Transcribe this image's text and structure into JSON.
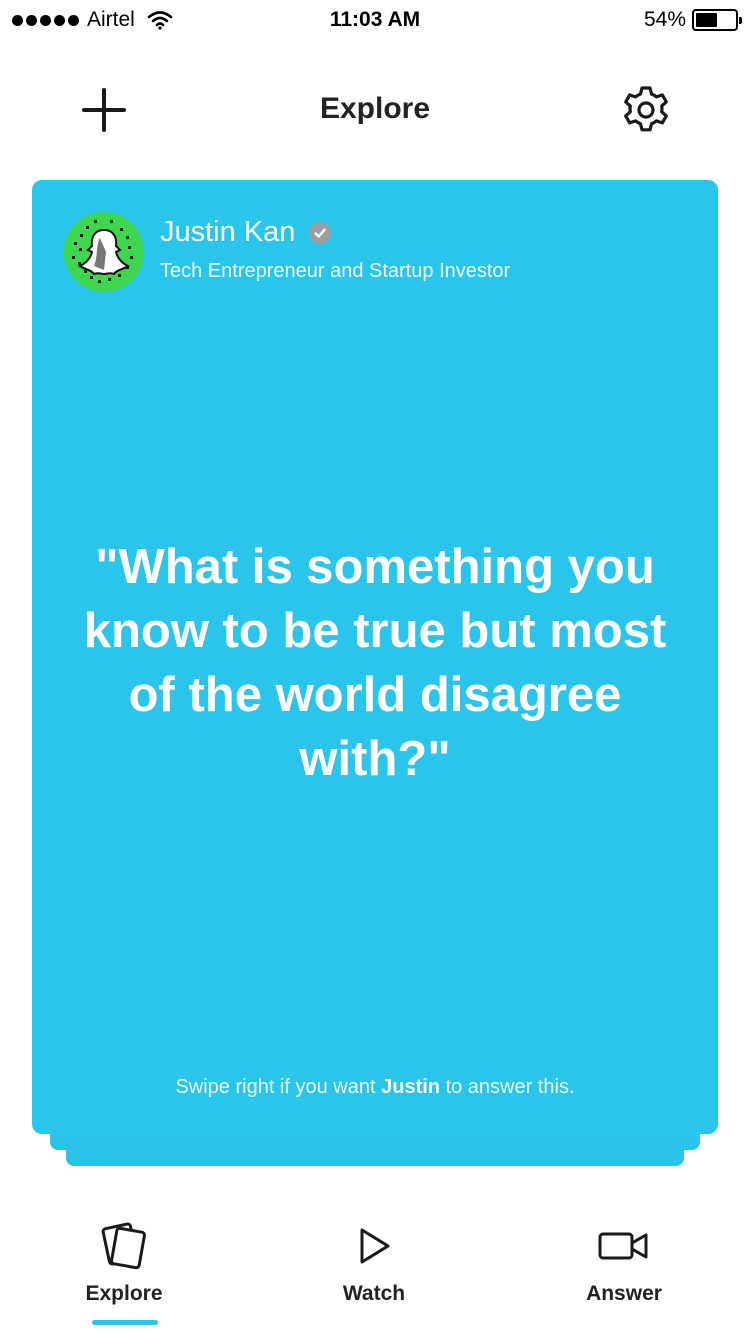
{
  "status_bar": {
    "carrier": "Airtel",
    "time": "11:03 AM",
    "battery_percent": "54%",
    "battery_level": 0.54,
    "signal_bars": 5
  },
  "header": {
    "title": "Explore",
    "left_icon": "plus-icon",
    "right_icon": "gear-icon"
  },
  "card": {
    "author_name": "Justin Kan",
    "author_title": "Tech Entrepreneur and Startup Investor",
    "verified_icon": "checkmark-icon",
    "question": "\"What is something you know to be true but most of the world disagree with?\"",
    "swipe_prefix": "Swipe right if you want ",
    "swipe_name": "Justin",
    "swipe_suffix": " to answer this.",
    "color": "#2bc4ea"
  },
  "tabs": [
    {
      "label": "Explore",
      "icon": "cards-icon",
      "active": true
    },
    {
      "label": "Watch",
      "icon": "play-icon",
      "active": false
    },
    {
      "label": "Answer",
      "icon": "video-camera-icon",
      "active": false
    }
  ]
}
